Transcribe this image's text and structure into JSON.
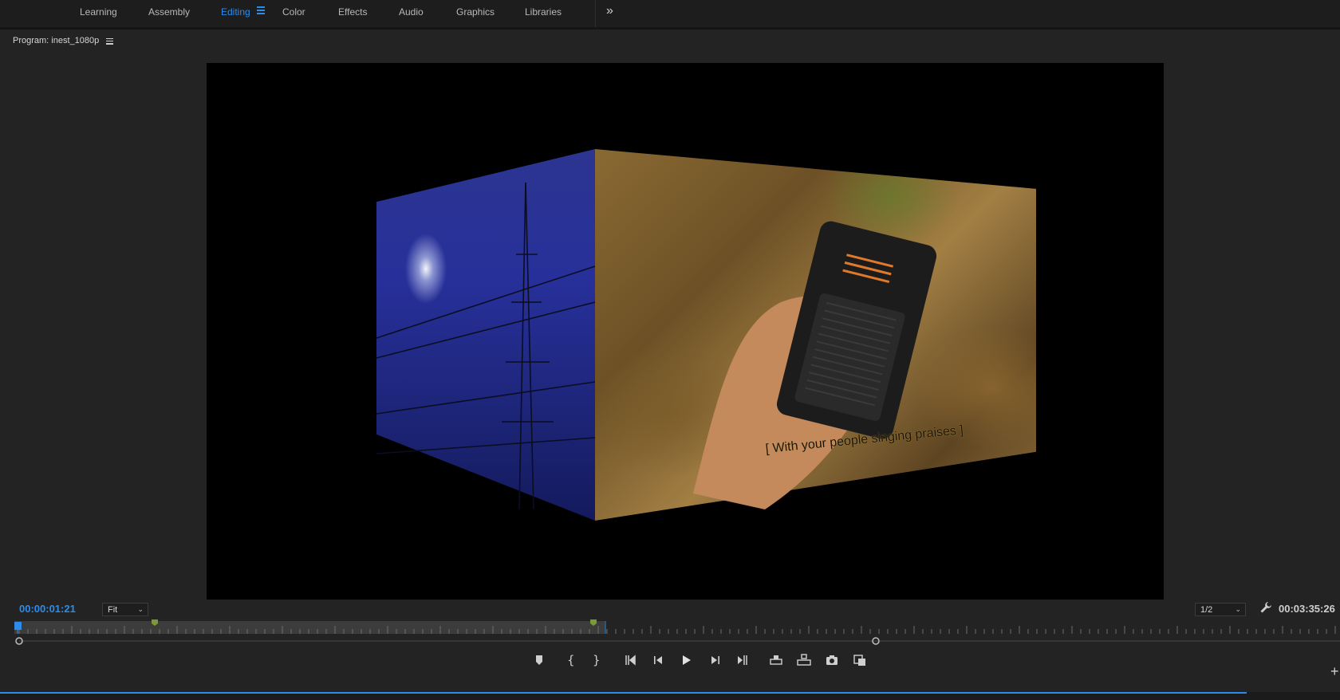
{
  "workspaces": {
    "tabs": [
      "Learning",
      "Assembly",
      "Editing",
      "Color",
      "Effects",
      "Audio",
      "Graphics",
      "Libraries"
    ],
    "active": "Editing",
    "more_label": "»"
  },
  "program": {
    "title": "Program: inest_1080p",
    "caption": "[ With your people singing praises ]"
  },
  "controls": {
    "current_timecode": "00:00:01:21",
    "fit_value": "Fit",
    "resolution_value": "1/2",
    "duration_timecode": "00:03:35:26"
  },
  "transport": {
    "buttons": [
      "add-marker",
      "mark-in",
      "mark-out",
      "go-to-in",
      "step-back",
      "play",
      "step-forward",
      "go-to-out",
      "lift",
      "extract",
      "export-frame",
      "compare-view"
    ]
  },
  "colors": {
    "accent": "#2d8ceb",
    "marker": "#7a9a3a"
  }
}
